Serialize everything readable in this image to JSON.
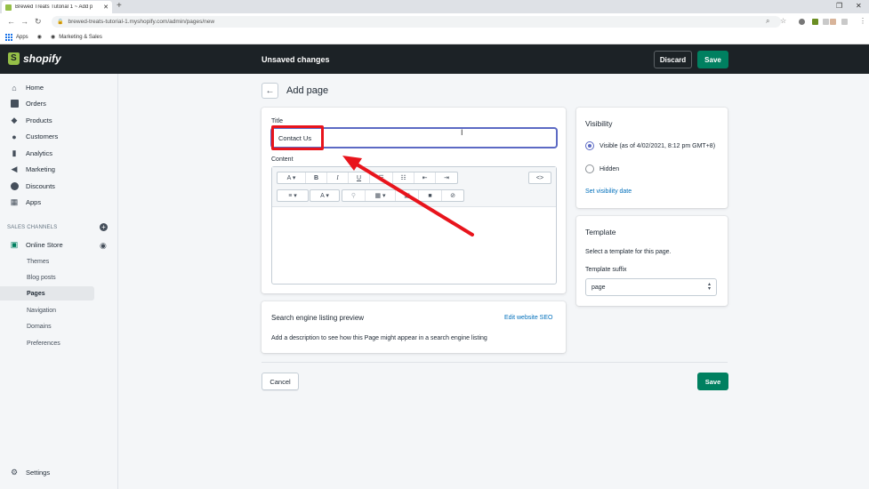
{
  "browser": {
    "tab_title": "Brewed Treats Tutorial 1 ~ Add p",
    "url": "brewed-treats-tutorial-1.myshopify.com/admin/pages/new",
    "bookmarks": [
      "Apps",
      "Marketing & Sales"
    ]
  },
  "topbar": {
    "brand": "shopify",
    "status": "Unsaved changes",
    "discard_label": "Discard",
    "save_label": "Save"
  },
  "sidebar": {
    "items": [
      {
        "label": "Home",
        "icon": "home-icon"
      },
      {
        "label": "Orders",
        "icon": "orders-icon"
      },
      {
        "label": "Products",
        "icon": "tag-icon"
      },
      {
        "label": "Customers",
        "icon": "person-icon"
      },
      {
        "label": "Analytics",
        "icon": "bar-chart-icon"
      },
      {
        "label": "Marketing",
        "icon": "megaphone-icon"
      },
      {
        "label": "Discounts",
        "icon": "discount-icon"
      },
      {
        "label": "Apps",
        "icon": "apps-icon"
      }
    ],
    "channels_header": "SALES CHANNELS",
    "online_store": "Online Store",
    "sub_items": [
      "Themes",
      "Blog posts",
      "Pages",
      "Navigation",
      "Domains",
      "Preferences"
    ],
    "active_sub_item": "Pages",
    "settings": "Settings"
  },
  "page": {
    "title": "Add page",
    "title_label": "Title",
    "title_value": "Contact Us",
    "content_label": "Content",
    "seo": {
      "heading": "Search engine listing preview",
      "edit_link": "Edit website SEO",
      "description": "Add a description to see how this Page might appear in a search engine listing"
    },
    "cancel_label": "Cancel",
    "save_label": "Save"
  },
  "visibility": {
    "heading": "Visibility",
    "visible_label": "Visible (as of 4/02/2021, 8:12 pm GMT+8)",
    "hidden_label": "Hidden",
    "selected": "visible",
    "set_date_link": "Set visibility date"
  },
  "template": {
    "heading": "Template",
    "description": "Select a template for this page.",
    "suffix_label": "Template suffix",
    "suffix_value": "page"
  },
  "colors": {
    "primary_green": "#008060",
    "topbar": "#1c2226",
    "annotation_red": "#e8141c",
    "focus": "#5c6ac4",
    "link": "#006fbb"
  }
}
